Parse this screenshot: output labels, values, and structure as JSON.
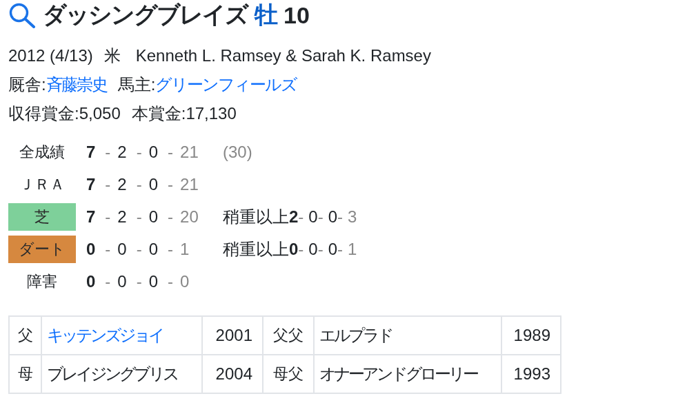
{
  "title": {
    "name": "ダッシングブレイズ",
    "sex": "牡",
    "age": "10"
  },
  "profile": {
    "birth": "2012 (4/13)",
    "country": "米",
    "breeder": "Kenneth L. Ramsey & Sarah K. Ramsey"
  },
  "connections": [
    {
      "label": "厩舎:",
      "value": "斉藤崇史"
    },
    {
      "label": "馬主:",
      "value": "グリーンフィールズ"
    }
  ],
  "prize_money": [
    "収得賞金:5,050",
    "本賞金:17,130"
  ],
  "records": [
    {
      "kind": "plain",
      "label": "全成績",
      "results": [
        {
          "value": "7"
        },
        {
          "dash": "-",
          "value": "2"
        },
        {
          "dash": "-",
          "value": "0"
        },
        {
          "dash": "-",
          "value": "21"
        }
      ],
      "note": "(30)"
    },
    {
      "kind": "plain",
      "label": "ＪＲＡ",
      "results": [
        {
          "value": "7"
        },
        {
          "dash": "-",
          "value": "2"
        },
        {
          "dash": "-",
          "value": "0"
        },
        {
          "dash": "-",
          "value": "21"
        }
      ]
    },
    {
      "kind": "badge",
      "label": "芝",
      "color": "#7ed09a",
      "results": [
        {
          "value": "7"
        },
        {
          "dash": "-",
          "value": "2"
        },
        {
          "dash": "-",
          "value": "0"
        },
        {
          "dash": "-",
          "value": "20"
        }
      ],
      "heavy": {
        "label": "稍重以上",
        "results": [
          {
            "value": "2"
          },
          {
            "dash": "-",
            "value": "0"
          },
          {
            "dash": "-",
            "value": "0"
          },
          {
            "dash": "-",
            "value": "3"
          }
        ]
      }
    },
    {
      "kind": "badge",
      "label": "ダート",
      "color": "#d6883f",
      "results": [
        {
          "value": "0"
        },
        {
          "dash": "-",
          "value": "0"
        },
        {
          "dash": "-",
          "value": "0"
        },
        {
          "dash": "-",
          "value": "1"
        }
      ],
      "heavy": {
        "label": "稍重以上",
        "results": [
          {
            "value": "0"
          },
          {
            "dash": "-",
            "value": "0"
          },
          {
            "dash": "-",
            "value": "0"
          },
          {
            "dash": "-",
            "value": "1"
          }
        ]
      }
    },
    {
      "kind": "plain",
      "label": "障害",
      "results": [
        {
          "value": "0"
        },
        {
          "dash": "-",
          "value": "0"
        },
        {
          "dash": "-",
          "value": "0"
        },
        {
          "dash": "-",
          "value": "0"
        }
      ]
    }
  ],
  "pedigree": [
    {
      "relation": "父",
      "horse": "キッテンズジョイ",
      "link": true,
      "year": "2001",
      "grand_relation": "父父",
      "grand_horse": "エルプラド",
      "grand_year": "1989"
    },
    {
      "relation": "母",
      "horse": "ブレイジングブリス",
      "link": false,
      "year": "2004",
      "grand_relation": "母父",
      "grand_horse": "オナーアンドグローリー",
      "grand_year": "1993"
    }
  ]
}
